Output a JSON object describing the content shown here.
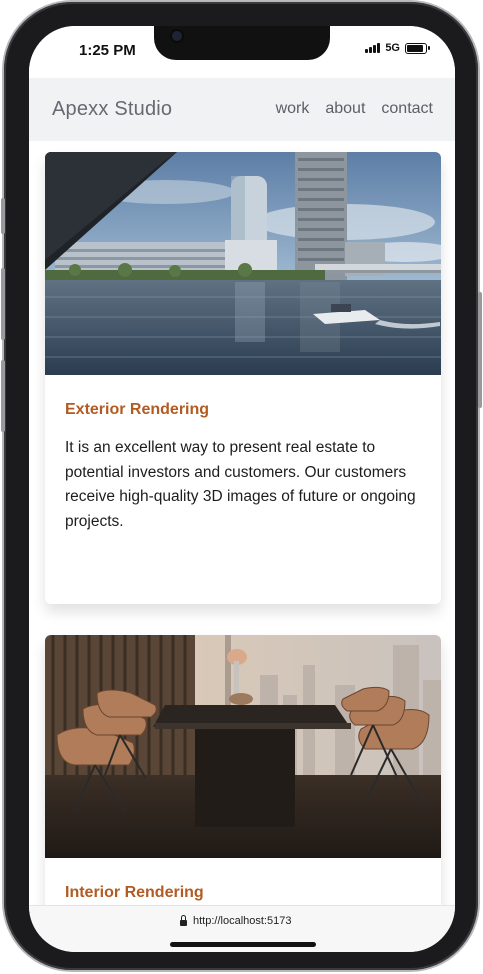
{
  "status_bar": {
    "time": "1:25 PM",
    "network": "5G"
  },
  "navbar": {
    "brand": "Apexx Studio",
    "links": [
      "work",
      "about",
      "contact"
    ]
  },
  "cards": [
    {
      "title": "Exterior Rendering",
      "text": "It is an excellent way to present real estate to potential investors and customers. Our customers receive high-quality 3D images of future or ongoing projects.",
      "image_icon": "city-waterfront-image"
    },
    {
      "title": "Interior Rendering",
      "text": "",
      "image_icon": "dining-room-image"
    }
  ],
  "browser": {
    "url": "http://localhost:5173"
  },
  "colors": {
    "accent": "#b25b22",
    "navbar_bg": "#f1f2f4",
    "nav_text": "#5b6067"
  }
}
